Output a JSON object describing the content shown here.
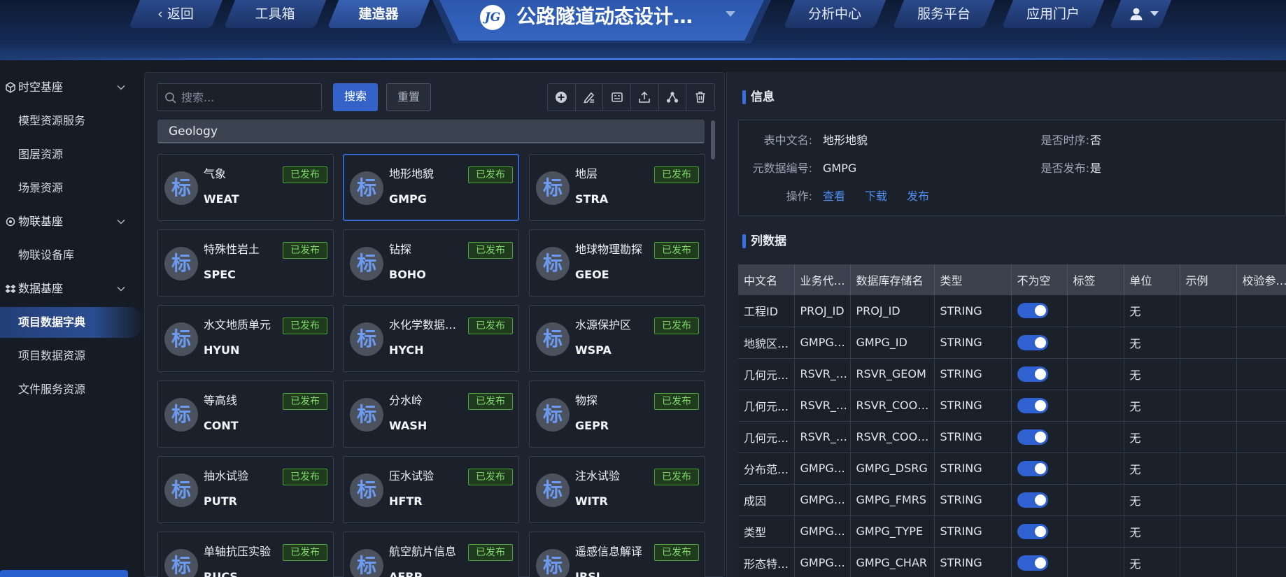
{
  "nav": {
    "back_label": "返回",
    "toolbox_label": "工具箱",
    "builder_label": "建造器",
    "app_title": "公路隧道动态设计…",
    "analysis_label": "分析中心",
    "service_label": "服务平台",
    "portal_label": "应用门户",
    "logo_text": "JG"
  },
  "sidebar": {
    "groups": [
      {
        "label": "时空基座",
        "icon": "cube-icon"
      },
      {
        "label": "物联基座",
        "icon": "iot-icon"
      },
      {
        "label": "数据基座",
        "icon": "dropbox-icon"
      }
    ],
    "items": [
      {
        "label": "模型资源服务"
      },
      {
        "label": "图层资源"
      },
      {
        "label": "场景资源"
      },
      {
        "label": "物联设备库"
      },
      {
        "label": "项目数据字典",
        "active": true
      },
      {
        "label": "项目数据资源"
      },
      {
        "label": "文件服务资源"
      }
    ]
  },
  "search": {
    "placeholder": "搜索...",
    "value": "",
    "search_label": "搜索",
    "reset_label": "重置"
  },
  "toolbar_icons": [
    "add-icon",
    "edit-icon",
    "form-icon",
    "upload-icon",
    "relation-icon",
    "delete-icon"
  ],
  "group": {
    "name": "Geology"
  },
  "cards": [
    {
      "badge": "标",
      "name": "气象",
      "code": "WEAT",
      "status": "已发布"
    },
    {
      "badge": "标",
      "name": "地形地貌",
      "code": "GMPG",
      "status": "已发布",
      "selected": true
    },
    {
      "badge": "标",
      "name": "地层",
      "code": "STRA",
      "status": "已发布"
    },
    {
      "badge": "标",
      "name": "特殊性岩土",
      "code": "SPEC",
      "status": "已发布"
    },
    {
      "badge": "标",
      "name": "钻探",
      "code": "BOHO",
      "status": "已发布"
    },
    {
      "badge": "标",
      "name": "地球物理勘探",
      "code": "GEOE",
      "status": "已发布"
    },
    {
      "badge": "标",
      "name": "水文地质单元",
      "code": "HYUN",
      "status": "已发布"
    },
    {
      "badge": "标",
      "name": "水化学数据…",
      "code": "HYCH",
      "status": "已发布"
    },
    {
      "badge": "标",
      "name": "水源保护区",
      "code": "WSPA",
      "status": "已发布"
    },
    {
      "badge": "标",
      "name": "等高线",
      "code": "CONT",
      "status": "已发布"
    },
    {
      "badge": "标",
      "name": "分水岭",
      "code": "WASH",
      "status": "已发布"
    },
    {
      "badge": "标",
      "name": "物探",
      "code": "GEPR",
      "status": "已发布"
    },
    {
      "badge": "标",
      "name": "抽水试验",
      "code": "PUTR",
      "status": "已发布"
    },
    {
      "badge": "标",
      "name": "压水试验",
      "code": "HFTR",
      "status": "已发布"
    },
    {
      "badge": "标",
      "name": "注水试验",
      "code": "WITR",
      "status": "已发布"
    },
    {
      "badge": "标",
      "name": "单轴抗压实验",
      "code": "RUCS",
      "status": "已发布"
    },
    {
      "badge": "标",
      "name": "航空航片信息",
      "code": "AERP",
      "status": "已发布"
    },
    {
      "badge": "标",
      "name": "遥感信息解译",
      "code": "IRSI",
      "status": "已发布"
    }
  ],
  "info": {
    "title": "信息",
    "cn_name_label": "表中文名:",
    "cn_name": "地形地貌",
    "timeseries_label": "是否时序:",
    "timeseries": "否",
    "meta_code_label": "元数据编号:",
    "meta_code": "GMPG",
    "published_label": "是否发布:",
    "published": "是",
    "ops_label": "操作:",
    "view_link": "查看",
    "download_link": "下载",
    "publish_link": "发布"
  },
  "columns": {
    "title": "列数据",
    "headers": [
      "中文名",
      "业务代…",
      "数据库存储名",
      "类型",
      "不为空",
      "标签",
      "单位",
      "示例",
      "校验参…"
    ],
    "rows": [
      {
        "cn": "工程ID",
        "biz": "PROJ_ID",
        "db": "PROJ_ID",
        "type": "STRING",
        "notnull": true,
        "tag": "",
        "unit": "无",
        "example": "",
        "check": ""
      },
      {
        "cn": "地貌区…",
        "biz": "GMPG…",
        "db": "GMPG_ID",
        "type": "STRING",
        "notnull": true,
        "tag": "",
        "unit": "无",
        "example": "",
        "check": ""
      },
      {
        "cn": "几何元…",
        "biz": "RSVR_…",
        "db": "RSVR_GEOM",
        "type": "STRING",
        "notnull": true,
        "tag": "",
        "unit": "无",
        "example": "",
        "check": ""
      },
      {
        "cn": "几何元…",
        "biz": "RSVR_…",
        "db": "RSVR_COO…",
        "type": "STRING",
        "notnull": true,
        "tag": "",
        "unit": "无",
        "example": "",
        "check": ""
      },
      {
        "cn": "几何元…",
        "biz": "RSVR_…",
        "db": "RSVR_COO…",
        "type": "STRING",
        "notnull": true,
        "tag": "",
        "unit": "无",
        "example": "",
        "check": ""
      },
      {
        "cn": "分布范…",
        "biz": "GMPG…",
        "db": "GMPG_DSRG",
        "type": "STRING",
        "notnull": true,
        "tag": "",
        "unit": "无",
        "example": "",
        "check": ""
      },
      {
        "cn": "成因",
        "biz": "GMPG…",
        "db": "GMPG_FMRS",
        "type": "STRING",
        "notnull": true,
        "tag": "",
        "unit": "无",
        "example": "",
        "check": ""
      },
      {
        "cn": "类型",
        "biz": "GMPG…",
        "db": "GMPG_TYPE",
        "type": "STRING",
        "notnull": true,
        "tag": "",
        "unit": "无",
        "example": "",
        "check": ""
      },
      {
        "cn": "形态特…",
        "biz": "GMPG…",
        "db": "GMPG_CHAR",
        "type": "STRING",
        "notnull": true,
        "tag": "",
        "unit": "无",
        "example": "",
        "check": ""
      }
    ]
  },
  "colors": {
    "accent": "#3363c9",
    "status_border": "#4aa23a",
    "status_text": "#7fd86a",
    "link": "#4d8ef0",
    "badge_text": "#6d9bf2"
  }
}
